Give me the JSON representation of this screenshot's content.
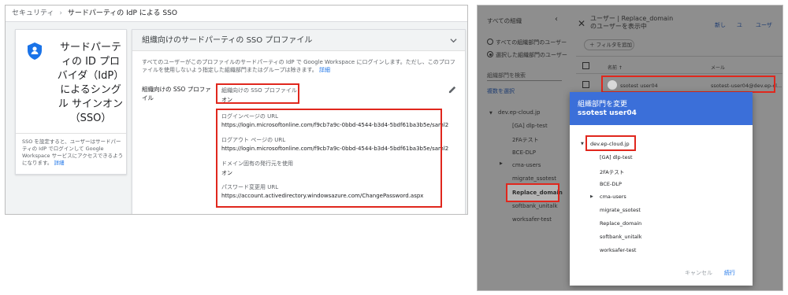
{
  "left_panel": {
    "breadcrumb": {
      "root": "セキュリティ",
      "separator": "›",
      "current": "サードパーティの IdP による SSO"
    },
    "card": {
      "icon": "shield-icon",
      "title": "サードパーティの ID プロバイダ（IdP）によるシングル サインオン（SSO）",
      "description": "SSO を設定すると、ユーザーはサードパーティの IdP でログインして Google Workspace サービスにアクセスできるようになります。",
      "more_link": "詳細"
    },
    "section": {
      "title": "組織向けのサードパーティの SSO プロファイル",
      "intro": "すべてのユーザーがこのプロファイルのサードパーティの IdP で Google Workspace にログインします。ただし、このプロファイルを使用しないよう指定した組織部門またはグループは除きます。",
      "intro_link": "詳細",
      "row_label": "組織向けの SSO プロファイル",
      "fields": [
        {
          "label": "組織向けの SSO プロファイル",
          "value": "オン"
        },
        {
          "label": "ログインページの URL",
          "value": "https://login.microsoftonline.com/f9cb7a9c-0bbd-4544-b3d4-5bdf61ba3b5e/saml2"
        },
        {
          "label": "ログアウト ページの URL",
          "value": "https://login.microsoftonline.com/f9cb7a9c-0bbd-4544-b3d4-5bdf61ba3b5e/saml2"
        },
        {
          "label": "ドメイン固有の発行元を使用",
          "value": "オン"
        },
        {
          "label": "パスワード変更用 URL",
          "value": "https://account.activedirectory.windowsazure.com/ChangePassword.aspx"
        }
      ]
    }
  },
  "right_panel": {
    "sidebar": {
      "title": "すべての組織",
      "radio_all": "すべての組織部門のユーザー",
      "radio_selected": "選択した組織部門のユーザー",
      "search_placeholder": "組織部門を検索",
      "multi_select": "複数を選択",
      "root_org": "dev.ep-cloud.jp",
      "orgs": [
        "[GA] dlp-test",
        "2FAテスト",
        "BCE-DLP",
        "cma-users",
        "migrate_ssotest",
        "Replace_domain",
        "softbank_unitalk",
        "worksafer-test"
      ]
    },
    "main": {
      "header": "ユーザー | Replace_domain のユーザーを表示中",
      "actions": [
        "新し",
        "ユ",
        "ユーザ"
      ],
      "filter_chip": "フィルタを追加",
      "col_name": "名前 ↑",
      "col_email": "メール",
      "user": {
        "name": "ssotest user04",
        "email": "ssotest-user04@dev.ep-cl..."
      }
    },
    "dialog": {
      "title": "組織部門を変更",
      "subtitle": "ssotest user04",
      "root_org": "dev.ep-cloud.jp",
      "orgs": [
        "[GA] dlp-test",
        "2FAテスト",
        "BCE-DLP",
        "cma-users",
        "migrate_ssotest",
        "Replace_domain",
        "softbank_unitalk",
        "worksafer-test"
      ],
      "cancel": "キャンセル",
      "continue": "続行"
    }
  },
  "colors": {
    "highlight": "#e0271d",
    "accent": "#3b6fd9",
    "link": "#1a73e8"
  }
}
